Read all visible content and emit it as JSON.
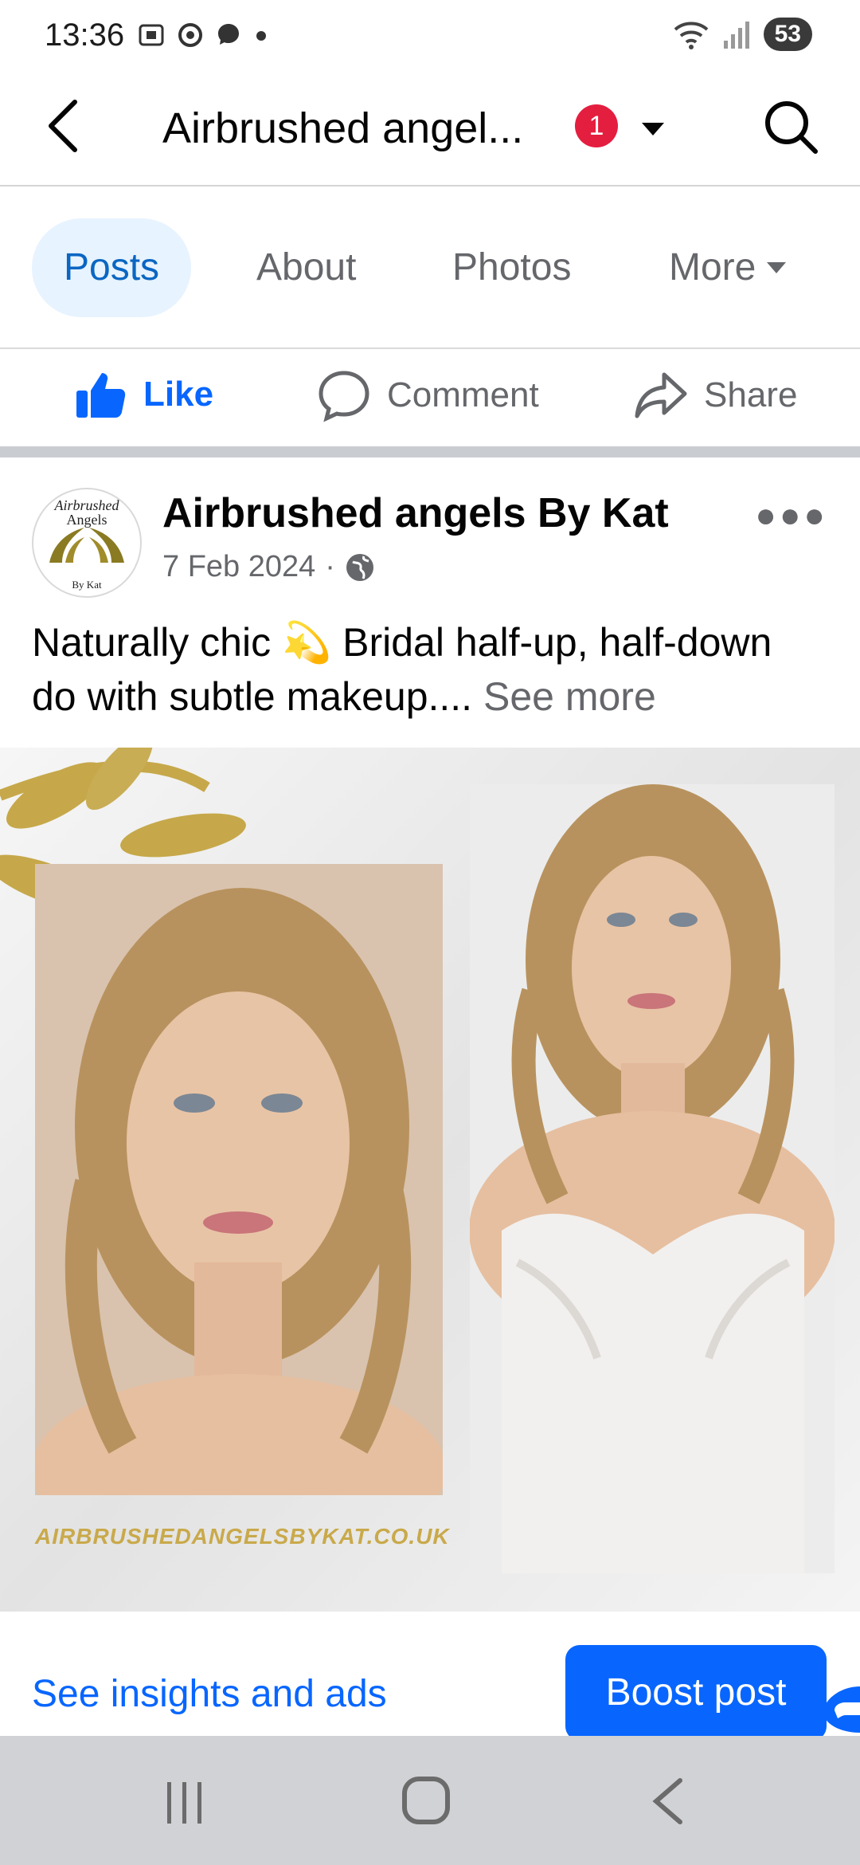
{
  "status_bar": {
    "time": "13:36",
    "battery": "53",
    "left_icons": [
      "screenshot-icon",
      "vpn-icon",
      "messenger-icon",
      "dot-icon"
    ],
    "right_icons": [
      "wifi-icon",
      "signal-icon"
    ]
  },
  "app_bar": {
    "title": "Airbrushed angel...",
    "notification_count": "1"
  },
  "tabs": [
    {
      "label": "Posts",
      "active": true
    },
    {
      "label": "About",
      "active": false
    },
    {
      "label": "Photos",
      "active": false
    },
    {
      "label": "More",
      "active": false
    }
  ],
  "actions": {
    "like": "Like",
    "comment": "Comment",
    "share": "Share"
  },
  "post": {
    "author": "Airbrushed angels By Kat",
    "date": "7 Feb 2024",
    "separator": "·",
    "text_line1": "Naturally chic 💫 Bridal half-up, half-down",
    "text_line2": "do with subtle makeup....",
    "see_more": "See more",
    "avatar_text_top": "Airbrushed",
    "avatar_text_mid": "Angels",
    "avatar_text_bottom": "By Kat",
    "watermark": "AIRBRUSHEDANGELSBYKAT.CO.UK"
  },
  "footer": {
    "insights": "See insights and ads",
    "boost": "Boost post"
  },
  "colors": {
    "accent": "#0866ff",
    "badge": "#e41e3f",
    "gold": "#c9a94a"
  }
}
